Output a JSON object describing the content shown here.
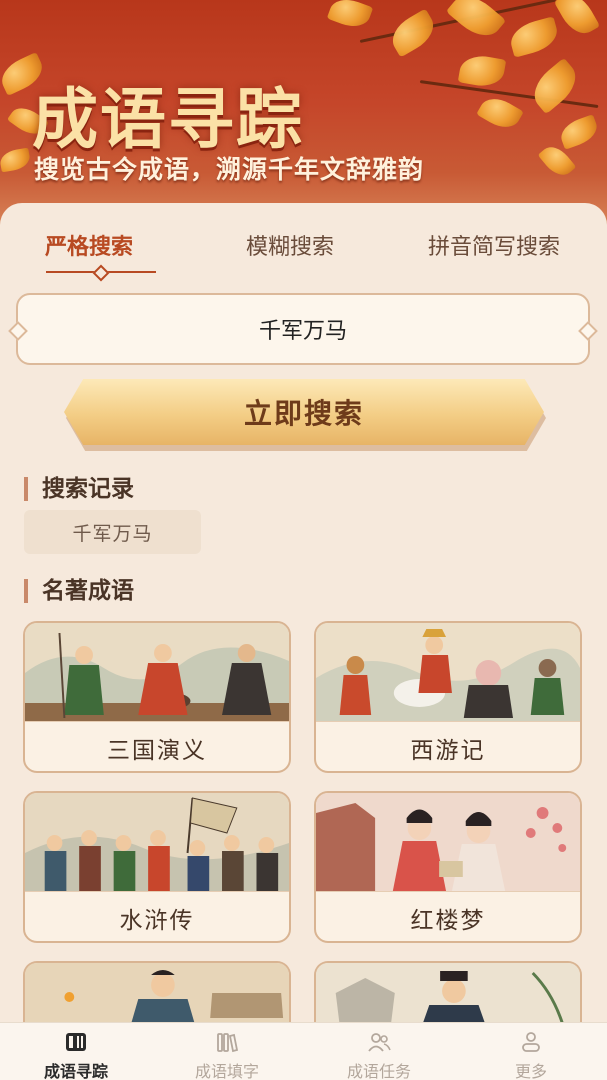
{
  "header": {
    "title": "成语寻踪",
    "subtitle": "搜览古今成语，溯源千年文辞雅韵"
  },
  "tabs": [
    {
      "label": "严格搜索",
      "active": true
    },
    {
      "label": "模糊搜索",
      "active": false
    },
    {
      "label": "拼音简写搜索",
      "active": false
    }
  ],
  "search": {
    "value": "千军万马",
    "button_label": "立即搜索"
  },
  "history": {
    "title": "搜索记录",
    "items": [
      "千军万马"
    ]
  },
  "classics": {
    "title": "名著成语",
    "cards": [
      {
        "name": "三国演义"
      },
      {
        "name": "西游记"
      },
      {
        "name": "水浒传"
      },
      {
        "name": "红楼梦"
      }
    ]
  },
  "nav": [
    {
      "label": "成语寻踪",
      "icon": "book-icon",
      "active": true
    },
    {
      "label": "成语填字",
      "icon": "books-icon",
      "active": false
    },
    {
      "label": "成语任务",
      "icon": "users-icon",
      "active": false
    },
    {
      "label": "更多",
      "icon": "user-icon",
      "active": false
    }
  ],
  "colors": {
    "accent": "#b84a22",
    "banner": "#c5462a",
    "button_gold": "#f3cd85",
    "panel_bg": "#f6e9dc"
  }
}
